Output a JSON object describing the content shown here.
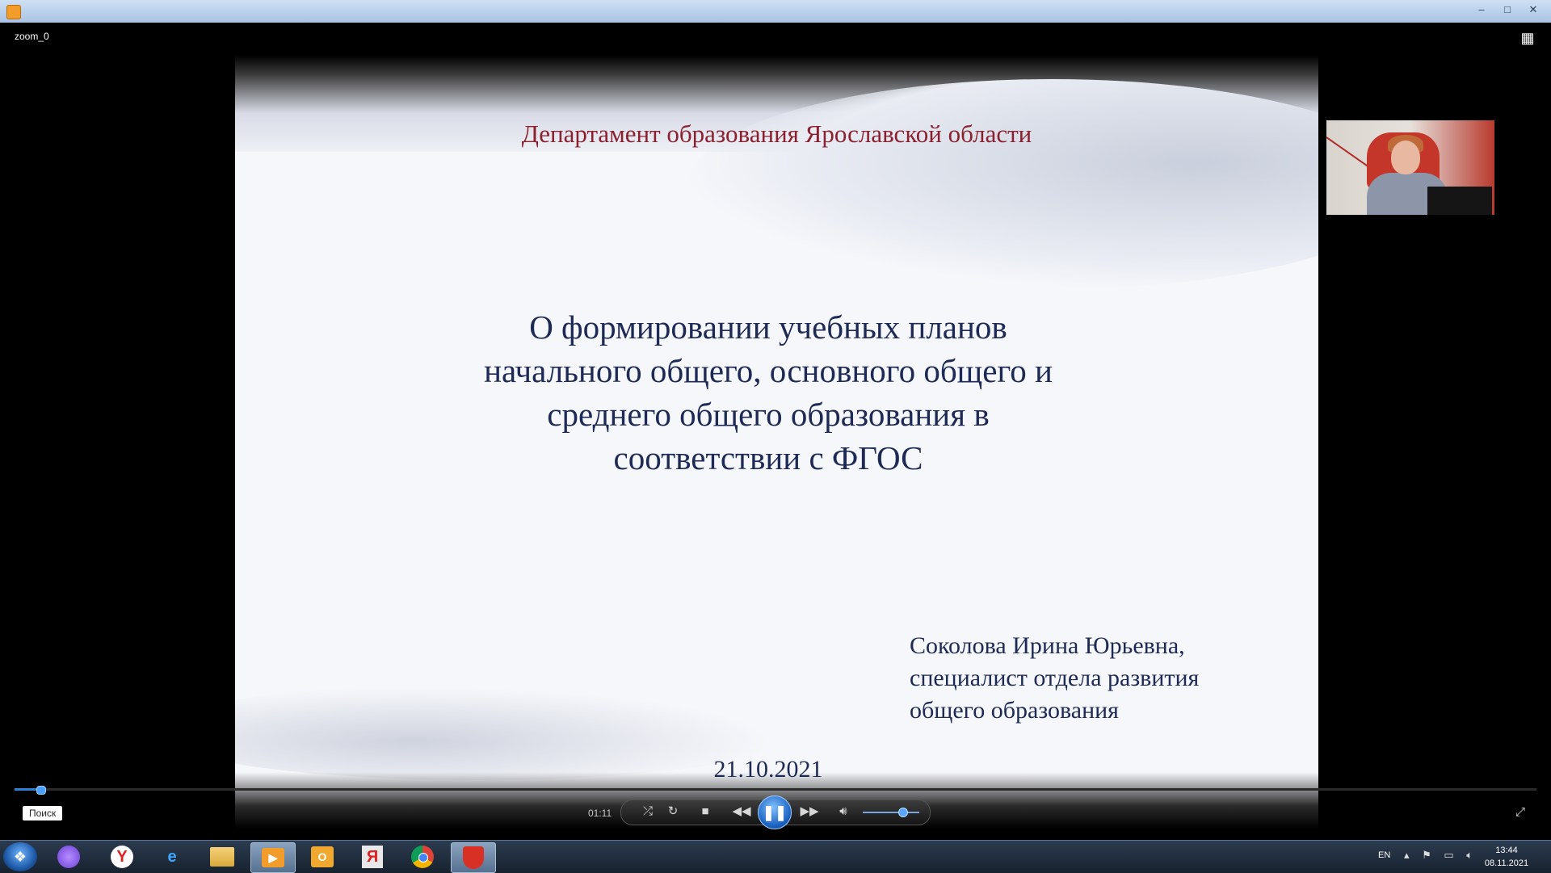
{
  "window": {
    "title_bar_controls": [
      "–",
      "□",
      "✕"
    ],
    "name": "zoom_0"
  },
  "slide": {
    "department": "Департамент образования Ярославской области",
    "title_lines": [
      "О формировании учебных планов",
      "начального общего, основного общего и",
      "среднего общего образования в",
      "соответствии с ФГОС"
    ],
    "author_lines": [
      "Соколова Ирина Юрьевна,",
      "специалист отдела развития",
      "общего образования"
    ],
    "date": "21.10.2021"
  },
  "player": {
    "search_label": "Поиск",
    "elapsed_time": "01:11",
    "progress_fraction": 0.017,
    "volume_fraction": 0.7,
    "icons": {
      "shuffle": "shuffle-icon",
      "repeat": "repeat-icon",
      "stop": "stop-icon",
      "rewind": "rewind-icon",
      "pause": "pause-icon",
      "forward": "fast-forward-icon",
      "volume": "volume-icon",
      "fullscreen": "switch-to-fullscreen-icon",
      "layout": "layout-icon"
    },
    "accent_color": "#2e7fd6"
  },
  "taskbar": {
    "apps": [
      "Alice",
      "Yandex Browser",
      "Internet Explorer",
      "Explorer",
      "Media Player",
      "Outlook",
      "Yandex",
      "Chrome",
      "Security"
    ],
    "language": "EN",
    "time": "13:44",
    "date": "08.11.2021"
  }
}
